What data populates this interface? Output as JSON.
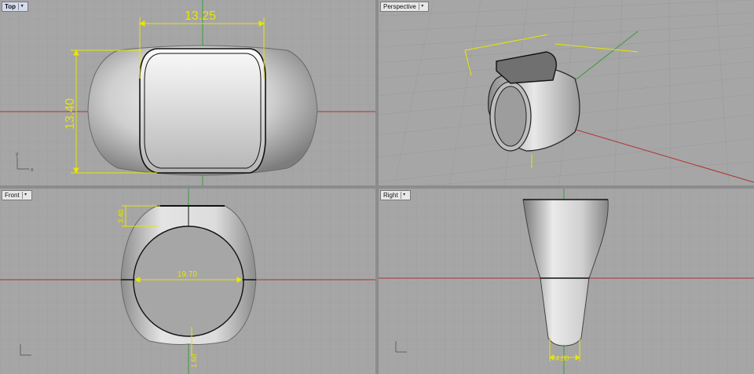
{
  "viewports": {
    "top": {
      "label": "Top",
      "active": true
    },
    "perspective": {
      "label": "Perspective",
      "active": false
    },
    "front": {
      "label": "Front",
      "active": false
    },
    "right": {
      "label": "Right",
      "active": false
    }
  },
  "dimensions": {
    "top_width": "13.25",
    "top_height": "13.40",
    "front_shank_width": "19.70",
    "front_head_height": "3.40",
    "front_bottom_thickness": "1.60",
    "right_bottom_width": "4.00"
  },
  "axes": {
    "x": "x",
    "y": "y"
  },
  "colors": {
    "dimension": "#e6e600",
    "x_axis": "#b03030",
    "y_axis": "#3a9a3a",
    "grid": "#999999",
    "viewport_bg": "#a6a6a6"
  }
}
